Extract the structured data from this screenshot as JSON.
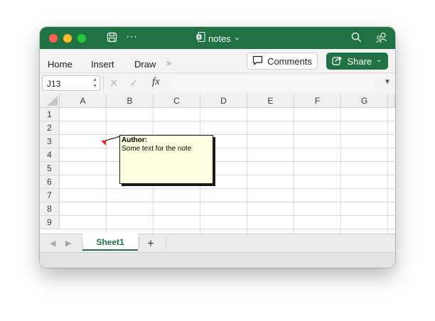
{
  "window": {
    "title": "notes",
    "title_chevron": "⌄"
  },
  "ribbon": {
    "tabs": [
      "Home",
      "Insert",
      "Draw"
    ],
    "more": "»",
    "comments_label": "Comments",
    "share_label": "Share",
    "share_chevron": "⌄"
  },
  "formula_bar": {
    "name_box": "J13",
    "fx_label": "fx",
    "formula": ""
  },
  "grid": {
    "columns": [
      "A",
      "B",
      "C",
      "D",
      "E",
      "F",
      "G"
    ],
    "rows": [
      "1",
      "2",
      "3",
      "4",
      "5",
      "6",
      "7",
      "8",
      "9"
    ]
  },
  "note": {
    "author": "Author:",
    "text": "Some text for the note"
  },
  "sheets": {
    "active": "Sheet1",
    "add": "+"
  },
  "colors": {
    "accent": "#207245",
    "note_bg": "#ffffe1",
    "note_marker": "#ff1a1a"
  },
  "icons": {
    "save": "save-icon",
    "more": "more-icon",
    "file": "excel-file-icon",
    "search": "search-icon",
    "collab": "people-icon",
    "comment": "comment-icon",
    "share": "share-icon"
  }
}
